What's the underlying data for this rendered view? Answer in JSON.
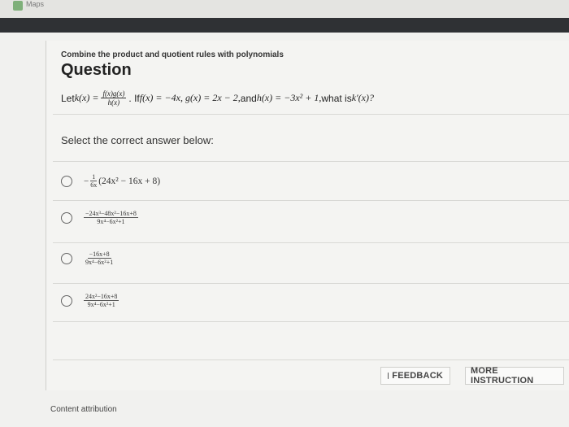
{
  "browser": {
    "bookmark_label": "Maps"
  },
  "lesson": {
    "subtitle": "Combine the product and quotient rules with polynomials",
    "title": "Question"
  },
  "question": {
    "lead": "Let ",
    "k_def": "k(x) = ",
    "frac_num": "f(x)g(x)",
    "frac_den": "h(x)",
    "mid": ". If ",
    "conditions": "f(x) = −4x, g(x) = 2x − 2,",
    "and": " and ",
    "h_def": "h(x) = −3x² + 1,",
    "ask": " what is ",
    "target": "k′(x)?"
  },
  "prompt": "Select the correct answer below:",
  "options": [
    {
      "prefix": "−",
      "frac_num": "1",
      "frac_den": "6x",
      "expr": "(24x² − 16x + 8)"
    },
    {
      "frac_num": "−24x³−48x²−16x+8",
      "frac_den": "9x⁴−6x²+1"
    },
    {
      "frac_num": "−16x+8",
      "frac_den": "9x⁴−6x²+1"
    },
    {
      "frac_num": "24x²−16x+8",
      "frac_den": "9x⁴−6x²+1"
    }
  ],
  "buttons": {
    "feedback": "FEEDBACK",
    "more": "MORE INSTRUCTION"
  },
  "footer": {
    "attribution": "Content attribution"
  }
}
